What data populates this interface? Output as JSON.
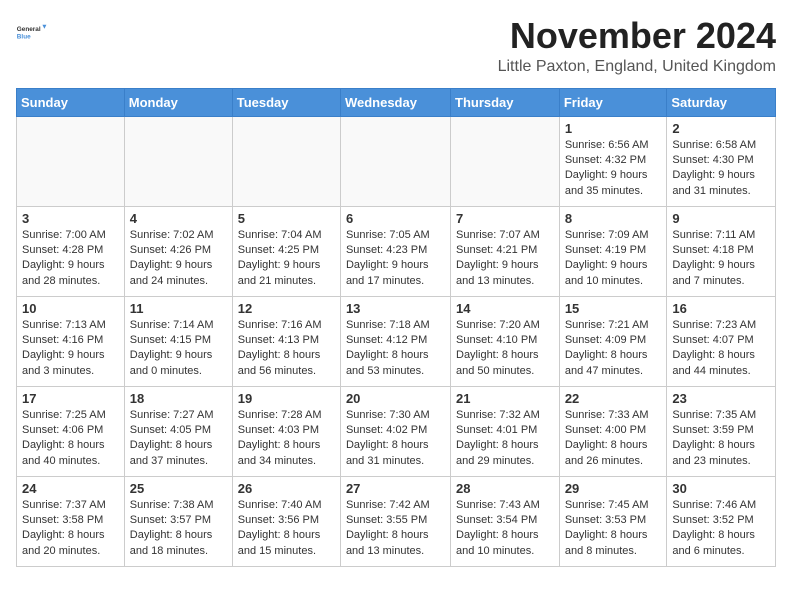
{
  "header": {
    "logo_line1": "General",
    "logo_line2": "Blue",
    "month_title": "November 2024",
    "location": "Little Paxton, England, United Kingdom"
  },
  "weekdays": [
    "Sunday",
    "Monday",
    "Tuesday",
    "Wednesday",
    "Thursday",
    "Friday",
    "Saturday"
  ],
  "weeks": [
    [
      {
        "day": "",
        "info": ""
      },
      {
        "day": "",
        "info": ""
      },
      {
        "day": "",
        "info": ""
      },
      {
        "day": "",
        "info": ""
      },
      {
        "day": "",
        "info": ""
      },
      {
        "day": "1",
        "info": "Sunrise: 6:56 AM\nSunset: 4:32 PM\nDaylight: 9 hours and 35 minutes."
      },
      {
        "day": "2",
        "info": "Sunrise: 6:58 AM\nSunset: 4:30 PM\nDaylight: 9 hours and 31 minutes."
      }
    ],
    [
      {
        "day": "3",
        "info": "Sunrise: 7:00 AM\nSunset: 4:28 PM\nDaylight: 9 hours and 28 minutes."
      },
      {
        "day": "4",
        "info": "Sunrise: 7:02 AM\nSunset: 4:26 PM\nDaylight: 9 hours and 24 minutes."
      },
      {
        "day": "5",
        "info": "Sunrise: 7:04 AM\nSunset: 4:25 PM\nDaylight: 9 hours and 21 minutes."
      },
      {
        "day": "6",
        "info": "Sunrise: 7:05 AM\nSunset: 4:23 PM\nDaylight: 9 hours and 17 minutes."
      },
      {
        "day": "7",
        "info": "Sunrise: 7:07 AM\nSunset: 4:21 PM\nDaylight: 9 hours and 13 minutes."
      },
      {
        "day": "8",
        "info": "Sunrise: 7:09 AM\nSunset: 4:19 PM\nDaylight: 9 hours and 10 minutes."
      },
      {
        "day": "9",
        "info": "Sunrise: 7:11 AM\nSunset: 4:18 PM\nDaylight: 9 hours and 7 minutes."
      }
    ],
    [
      {
        "day": "10",
        "info": "Sunrise: 7:13 AM\nSunset: 4:16 PM\nDaylight: 9 hours and 3 minutes."
      },
      {
        "day": "11",
        "info": "Sunrise: 7:14 AM\nSunset: 4:15 PM\nDaylight: 9 hours and 0 minutes."
      },
      {
        "day": "12",
        "info": "Sunrise: 7:16 AM\nSunset: 4:13 PM\nDaylight: 8 hours and 56 minutes."
      },
      {
        "day": "13",
        "info": "Sunrise: 7:18 AM\nSunset: 4:12 PM\nDaylight: 8 hours and 53 minutes."
      },
      {
        "day": "14",
        "info": "Sunrise: 7:20 AM\nSunset: 4:10 PM\nDaylight: 8 hours and 50 minutes."
      },
      {
        "day": "15",
        "info": "Sunrise: 7:21 AM\nSunset: 4:09 PM\nDaylight: 8 hours and 47 minutes."
      },
      {
        "day": "16",
        "info": "Sunrise: 7:23 AM\nSunset: 4:07 PM\nDaylight: 8 hours and 44 minutes."
      }
    ],
    [
      {
        "day": "17",
        "info": "Sunrise: 7:25 AM\nSunset: 4:06 PM\nDaylight: 8 hours and 40 minutes."
      },
      {
        "day": "18",
        "info": "Sunrise: 7:27 AM\nSunset: 4:05 PM\nDaylight: 8 hours and 37 minutes."
      },
      {
        "day": "19",
        "info": "Sunrise: 7:28 AM\nSunset: 4:03 PM\nDaylight: 8 hours and 34 minutes."
      },
      {
        "day": "20",
        "info": "Sunrise: 7:30 AM\nSunset: 4:02 PM\nDaylight: 8 hours and 31 minutes."
      },
      {
        "day": "21",
        "info": "Sunrise: 7:32 AM\nSunset: 4:01 PM\nDaylight: 8 hours and 29 minutes."
      },
      {
        "day": "22",
        "info": "Sunrise: 7:33 AM\nSunset: 4:00 PM\nDaylight: 8 hours and 26 minutes."
      },
      {
        "day": "23",
        "info": "Sunrise: 7:35 AM\nSunset: 3:59 PM\nDaylight: 8 hours and 23 minutes."
      }
    ],
    [
      {
        "day": "24",
        "info": "Sunrise: 7:37 AM\nSunset: 3:58 PM\nDaylight: 8 hours and 20 minutes."
      },
      {
        "day": "25",
        "info": "Sunrise: 7:38 AM\nSunset: 3:57 PM\nDaylight: 8 hours and 18 minutes."
      },
      {
        "day": "26",
        "info": "Sunrise: 7:40 AM\nSunset: 3:56 PM\nDaylight: 8 hours and 15 minutes."
      },
      {
        "day": "27",
        "info": "Sunrise: 7:42 AM\nSunset: 3:55 PM\nDaylight: 8 hours and 13 minutes."
      },
      {
        "day": "28",
        "info": "Sunrise: 7:43 AM\nSunset: 3:54 PM\nDaylight: 8 hours and 10 minutes."
      },
      {
        "day": "29",
        "info": "Sunrise: 7:45 AM\nSunset: 3:53 PM\nDaylight: 8 hours and 8 minutes."
      },
      {
        "day": "30",
        "info": "Sunrise: 7:46 AM\nSunset: 3:52 PM\nDaylight: 8 hours and 6 minutes."
      }
    ]
  ]
}
